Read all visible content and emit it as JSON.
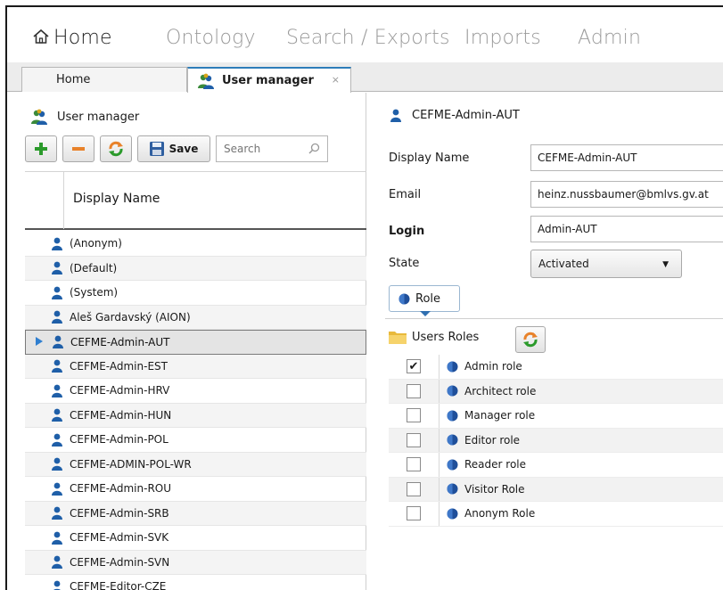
{
  "menu": {
    "home": "Home",
    "ontology": "Ontology",
    "search_exports": "Search / Exports",
    "imports": "Imports",
    "admin": "Admin"
  },
  "doc_tabs": {
    "home": "Home",
    "user_manager": "User manager",
    "close_glyph": "⨯"
  },
  "left_panel": {
    "title": "User manager",
    "save_label": "Save",
    "search_placeholder": "Search",
    "column_header": "Display Name",
    "users": [
      {
        "name": "(Anonym)",
        "selected": false
      },
      {
        "name": "(Default)",
        "selected": false
      },
      {
        "name": "(System)",
        "selected": false
      },
      {
        "name": "Aleš Gardavský (AION)",
        "selected": false
      },
      {
        "name": "CEFME-Admin-AUT",
        "selected": true
      },
      {
        "name": "CEFME-Admin-EST",
        "selected": false
      },
      {
        "name": "CEFME-Admin-HRV",
        "selected": false
      },
      {
        "name": "CEFME-Admin-HUN",
        "selected": false
      },
      {
        "name": "CEFME-Admin-POL",
        "selected": false
      },
      {
        "name": "CEFME-ADMIN-POL-WR",
        "selected": false
      },
      {
        "name": "CEFME-Admin-ROU",
        "selected": false
      },
      {
        "name": "CEFME-Admin-SRB",
        "selected": false
      },
      {
        "name": "CEFME-Admin-SVK",
        "selected": false
      },
      {
        "name": "CEFME-Admin-SVN",
        "selected": false
      },
      {
        "name": "CEFME-Editor-CZE",
        "selected": false
      }
    ]
  },
  "right_panel": {
    "title": "CEFME-Admin-AUT",
    "display_name_label": "Display Name",
    "display_name_value": "CEFME-Admin-AUT",
    "email_label": "Email",
    "email_value": "heinz.nussbaumer@bmlvs.gv.at",
    "login_label": "Login",
    "login_value": "Admin-AUT",
    "state_label": "State",
    "state_value": "Activated",
    "role_tab": "Role",
    "users_roles_label": "Users Roles",
    "roles": [
      {
        "name": "Admin role",
        "checked": true
      },
      {
        "name": "Architect role",
        "checked": false
      },
      {
        "name": "Manager role",
        "checked": false
      },
      {
        "name": "Editor role",
        "checked": false
      },
      {
        "name": "Reader role",
        "checked": false
      },
      {
        "name": "Visitor Role",
        "checked": false
      },
      {
        "name": "Anonym Role",
        "checked": false
      }
    ]
  },
  "colors": {
    "user_icon_blue": "#1f5fa8",
    "plus_green": "#2b9a2b",
    "minus_orange": "#e8822a",
    "tab_accent": "#2e7db9"
  },
  "icons": {
    "home": "home-icon",
    "users": "users-group-icon",
    "user": "user-icon",
    "add": "plus-icon",
    "remove": "minus-icon",
    "refresh": "refresh-icon",
    "save": "floppy-disk-icon",
    "search": "search-icon",
    "role": "role-sphere-icon",
    "folder": "folder-icon",
    "row_pointer": "row-pointer-icon",
    "dropdown": "chevron-down-icon",
    "close": "close-icon"
  }
}
